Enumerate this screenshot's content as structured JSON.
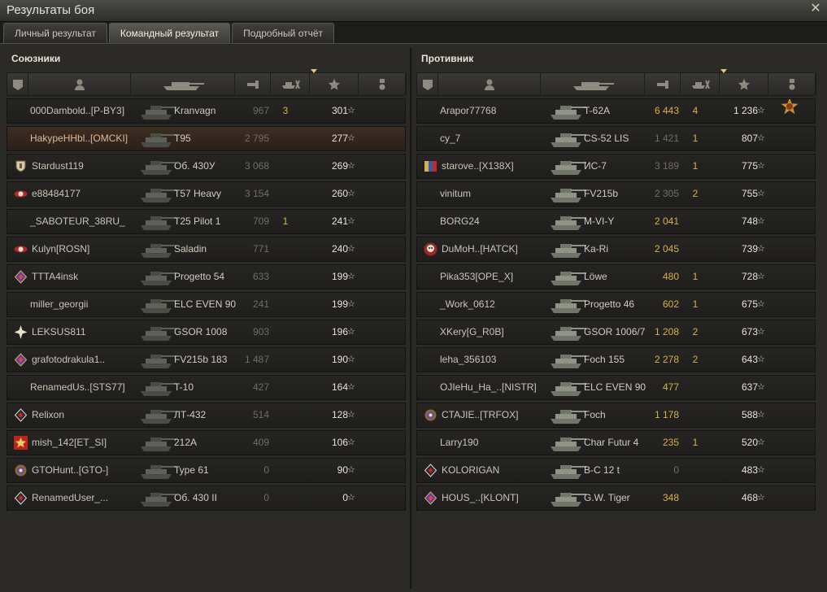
{
  "window": {
    "title": "Результаты боя",
    "close_label": "✕"
  },
  "tabs": [
    {
      "label": "Личный результат",
      "active": false
    },
    {
      "label": "Командный результат",
      "active": true
    },
    {
      "label": "Подробный отчёт",
      "active": false
    }
  ],
  "allies": {
    "title": "Союзники",
    "rows": [
      {
        "name": "000Dambold..[P-BY3]",
        "badge": "",
        "tank": "Kranvagn",
        "damage": "967",
        "frags": "3",
        "xp": "301",
        "dim": true
      },
      {
        "name": "HakypeHHbl..[OMCKI]",
        "badge": "",
        "tank": "T95",
        "damage": "2 795",
        "frags": "",
        "xp": "277",
        "dim": true,
        "me": true
      },
      {
        "name": "Stardust119",
        "badge": "shield",
        "tank": "Об. 430У",
        "damage": "3 068",
        "frags": "",
        "xp": "269",
        "dim": true
      },
      {
        "name": "e88484177",
        "badge": "wings-red",
        "tank": "T57 Heavy",
        "damage": "3 154",
        "frags": "",
        "xp": "260",
        "dim": true
      },
      {
        "name": "_SABOTEUR_38RU_",
        "badge": "",
        "tank": "T25 Pilot 1",
        "damage": "709",
        "frags": "1",
        "xp": "241",
        "dim": true
      },
      {
        "name": "Kulyn[ROSN]",
        "badge": "wings-red",
        "tank": "Saladin",
        "damage": "771",
        "frags": "",
        "xp": "240",
        "dim": true
      },
      {
        "name": "TTTA4insk",
        "badge": "diamond-purple",
        "tank": "Progetto 54",
        "damage": "633",
        "frags": "",
        "xp": "199",
        "dim": true
      },
      {
        "name": "miller_georgii",
        "badge": "",
        "tank": "ELC EVEN 90",
        "damage": "241",
        "frags": "",
        "xp": "199",
        "dim": true
      },
      {
        "name": "LEKSUS811",
        "badge": "star-burst",
        "tank": "GSOR 1008",
        "damage": "903",
        "frags": "",
        "xp": "196",
        "dim": true
      },
      {
        "name": "grafotodrakula1..",
        "badge": "diamond-purple",
        "tank": "FV215b 183",
        "damage": "1 487",
        "frags": "",
        "xp": "190",
        "dim": true
      },
      {
        "name": "RenamedUs..[STS77]",
        "badge": "",
        "tank": "T-10",
        "damage": "427",
        "frags": "",
        "xp": "164",
        "dim": true
      },
      {
        "name": "Relixon",
        "badge": "diamond-white",
        "tank": "ЛТ-432",
        "damage": "514",
        "frags": "",
        "xp": "128",
        "dim": true
      },
      {
        "name": "mish_142[ET_SI]",
        "badge": "star-red",
        "tank": "212A",
        "damage": "409",
        "frags": "",
        "xp": "106",
        "dim": true
      },
      {
        "name": "GTOHunt..[GTO-]",
        "badge": "gear-purple",
        "tank": "Type 61",
        "damage": "0",
        "frags": "",
        "xp": "90",
        "dim": true
      },
      {
        "name": "RenamedUser_...",
        "badge": "diamond-white",
        "tank": "Об. 430 II",
        "damage": "0",
        "frags": "",
        "xp": "0",
        "dim": true
      }
    ]
  },
  "enemies": {
    "title": "Противник",
    "rows": [
      {
        "name": "Arapor77768",
        "badge": "",
        "tank": "T-62A",
        "damage": "6 443",
        "frags": "4",
        "xp": "1 236",
        "ach": true
      },
      {
        "name": "cy_7",
        "badge": "",
        "tank": "CS-52 LIS",
        "damage": "1 421",
        "frags": "1",
        "xp": "807",
        "dim": true
      },
      {
        "name": "starove..[X138X]",
        "badge": "flag-blue",
        "tank": "ИС-7",
        "damage": "3 189",
        "frags": "1",
        "xp": "775",
        "dim": true
      },
      {
        "name": "vinitum",
        "badge": "",
        "tank": "FV215b",
        "damage": "2 305",
        "frags": "2",
        "xp": "755",
        "dim": true
      },
      {
        "name": "BORG24",
        "badge": "",
        "tank": "M-VI-Y",
        "damage": "2 041",
        "frags": "",
        "xp": "748"
      },
      {
        "name": "DuMoH..[HATCK]",
        "badge": "skull",
        "tank": "Ka-Ri",
        "damage": "2 045",
        "frags": "",
        "xp": "739"
      },
      {
        "name": "Pika353[OPE_X]",
        "badge": "",
        "tank": "Löwe",
        "damage": "480",
        "frags": "1",
        "xp": "728"
      },
      {
        "name": "_Work_0612",
        "badge": "",
        "tank": "Progetto 46",
        "damage": "602",
        "frags": "1",
        "xp": "675"
      },
      {
        "name": "XKery[G_R0B]",
        "badge": "",
        "tank": "GSOR 1006/7",
        "damage": "1 208",
        "frags": "2",
        "xp": "673"
      },
      {
        "name": "leha_356103",
        "badge": "",
        "tank": "Foch 155",
        "damage": "2 278",
        "frags": "2",
        "xp": "643"
      },
      {
        "name": "OJIeHu_Ha_..[NISTR]",
        "badge": "",
        "tank": "ELC EVEN 90",
        "damage": "477",
        "frags": "",
        "xp": "637"
      },
      {
        "name": "CTAJIE..[TRFOX]",
        "badge": "gear-purple",
        "tank": "Foch",
        "damage": "1 178",
        "frags": "",
        "xp": "588"
      },
      {
        "name": "Larry190",
        "badge": "",
        "tank": "Char Futur 4",
        "damage": "235",
        "frags": "1",
        "xp": "520"
      },
      {
        "name": "KOLORIGAN",
        "badge": "diamond-white",
        "tank": "B-C 12 t",
        "damage": "0",
        "frags": "",
        "xp": "483",
        "dim": true
      },
      {
        "name": "HOUS_..[KLONT]",
        "badge": "diamond-purple",
        "tank": "G.W. Tiger",
        "damage": "348",
        "frags": "",
        "xp": "468"
      }
    ]
  },
  "columns": [
    "squad-icon",
    "player-icon",
    "tank-icon",
    "damage-icon",
    "frags-icon",
    "xp-star-icon",
    "achievement-icon"
  ],
  "colors": {
    "accent_gold": "#d8b04a",
    "player_row": "#3e2d22"
  }
}
